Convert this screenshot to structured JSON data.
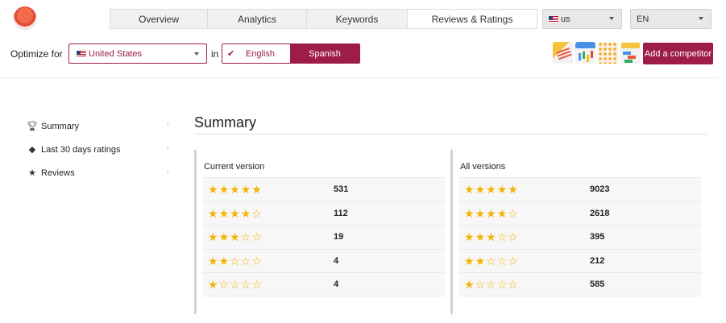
{
  "header": {
    "tabs": [
      {
        "label": "Overview",
        "active": false
      },
      {
        "label": "Analytics",
        "active": false
      },
      {
        "label": "Keywords",
        "active": false
      },
      {
        "label": "Reviews & Ratings",
        "active": true
      }
    ],
    "country_dropdown": "us",
    "language_dropdown": "EN"
  },
  "optimize": {
    "label": "Optimize for",
    "country": "United States",
    "in_label": "in",
    "languages": [
      {
        "label": "English",
        "selected": true
      },
      {
        "label": "Spanish",
        "selected": false
      }
    ],
    "add_competitor": "Add a competitor"
  },
  "sidebar": {
    "items": [
      {
        "label": "Summary",
        "icon": "trophy-icon"
      },
      {
        "label": "Last 30 days ratings",
        "icon": "tag-icon"
      },
      {
        "label": "Reviews",
        "icon": "star-icon"
      }
    ]
  },
  "main": {
    "title": "Summary",
    "panels": [
      {
        "title": "Current version",
        "rows": [
          {
            "stars": 5,
            "count": "531"
          },
          {
            "stars": 4,
            "count": "112"
          },
          {
            "stars": 3,
            "count": "19"
          },
          {
            "stars": 2,
            "count": "4"
          },
          {
            "stars": 1,
            "count": "4"
          }
        ]
      },
      {
        "title": "All versions",
        "rows": [
          {
            "stars": 5,
            "count": "9023"
          },
          {
            "stars": 4,
            "count": "2618"
          },
          {
            "stars": 3,
            "count": "395"
          },
          {
            "stars": 2,
            "count": "212"
          },
          {
            "stars": 1,
            "count": "585"
          }
        ]
      }
    ]
  },
  "colors": {
    "brand": "#9d1d48",
    "star": "#f5b301"
  }
}
